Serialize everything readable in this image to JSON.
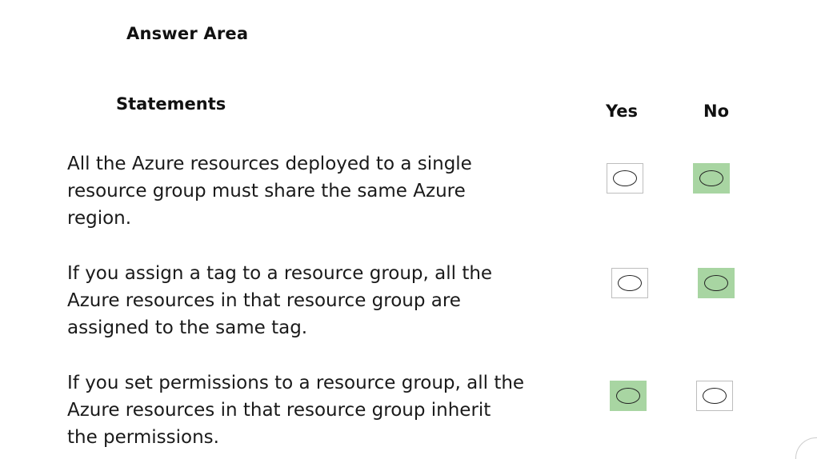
{
  "answer_area": {
    "title": "Answer Area"
  },
  "table": {
    "statements_heading": "Statements",
    "yes_heading": "Yes",
    "no_heading": "No",
    "rows": [
      {
        "text": "All the Azure resources deployed to a single\nresource group must share the same Azure\nregion.",
        "selected": "No"
      },
      {
        "text": "If you assign a tag to a resource group, all the\nAzure resources in that resource group are\nassigned to the same tag.",
        "selected": "No"
      },
      {
        "text": "If you set permissions to a resource group, all the\nAzure resources in that resource group inherit\nthe permissions.",
        "selected": "Yes"
      }
    ]
  },
  "colors": {
    "selected_fill": "#a8d5a2",
    "box_border": "#bdbdbd",
    "text": "#1a1a1a"
  }
}
